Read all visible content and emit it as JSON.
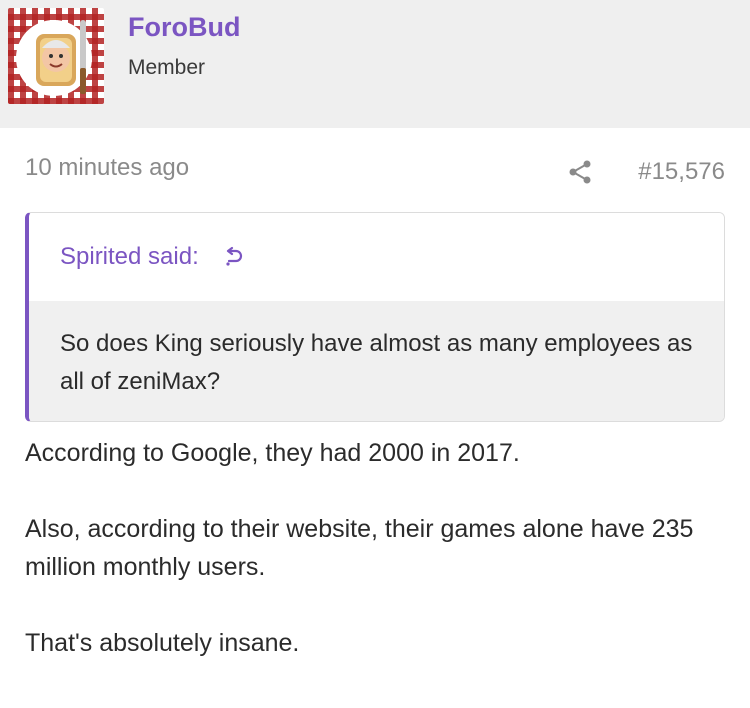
{
  "user": {
    "name": "ForoBud",
    "title": "Member"
  },
  "post": {
    "timestamp": "10 minutes ago",
    "number": "#15,576",
    "share_icon": "share-icon",
    "quote": {
      "author_label": "Spirited said:",
      "jump_icon": "quote-jump-icon",
      "text": "So does King seriously have almost as many employees as all of zeniMax?"
    },
    "paragraphs": [
      "According to Google, they had 2000 in 2017.",
      "Also, according to their website, their games alone have 235 million monthly users.",
      "That's absolutely insane."
    ]
  },
  "colors": {
    "accent": "#7b55c2",
    "header_bg": "#efefef",
    "quote_bg": "#f0f0f0",
    "muted_text": "#8a8a8a"
  }
}
